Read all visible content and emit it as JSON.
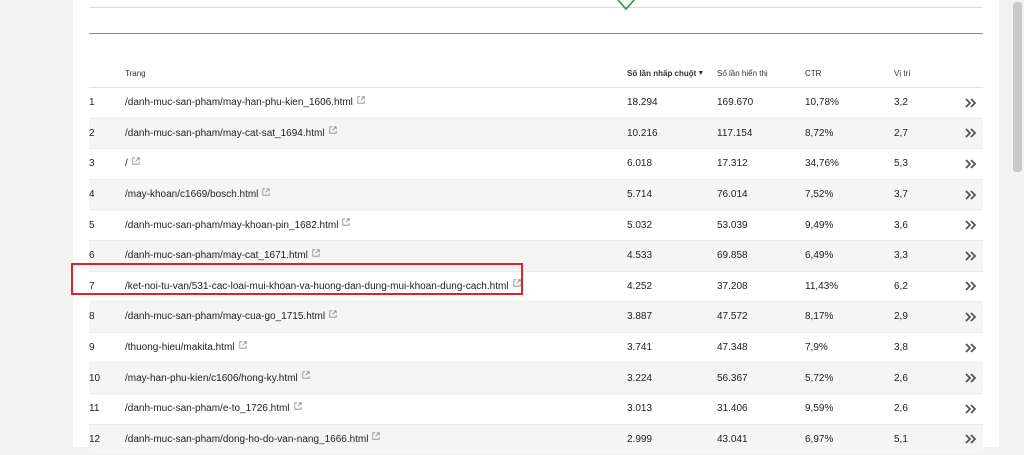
{
  "table": {
    "headers": {
      "page": "Trang",
      "clicks": "Số lần nhấp chuột",
      "sort_indicator": "▼",
      "impressions": "Số lần hiển thị",
      "ctr": "CTR",
      "position": "Vị trí"
    },
    "rows": [
      {
        "idx": "1",
        "page": "/danh-muc-san-pham/may-han-phu-kien_1606.html",
        "clicks": "18.294",
        "impressions": "169.670",
        "ctr": "10,78%",
        "position": "3,2"
      },
      {
        "idx": "2",
        "page": "/danh-muc-san-pham/may-cat-sat_1694.html",
        "clicks": "10.216",
        "impressions": "117.154",
        "ctr": "8,72%",
        "position": "2,7"
      },
      {
        "idx": "3",
        "page": "/",
        "clicks": "6.018",
        "impressions": "17.312",
        "ctr": "34,76%",
        "position": "5,3"
      },
      {
        "idx": "4",
        "page": "/may-khoan/c1669/bosch.html",
        "clicks": "5.714",
        "impressions": "76.014",
        "ctr": "7,52%",
        "position": "3,7"
      },
      {
        "idx": "5",
        "page": "/danh-muc-san-pham/may-khoan-pin_1682.html",
        "clicks": "5.032",
        "impressions": "53.039",
        "ctr": "9,49%",
        "position": "3,6"
      },
      {
        "idx": "6",
        "page": "/danh-muc-san-pham/may-cat_1671.html",
        "clicks": "4.533",
        "impressions": "69.858",
        "ctr": "6,49%",
        "position": "3,3"
      },
      {
        "idx": "7",
        "page": "/ket-noi-tu-van/531-cac-loai-mui-khoan-va-huong-dan-dung-mui-khoan-dung-cach.html",
        "clicks": "4.252",
        "impressions": "37.208",
        "ctr": "11,43%",
        "position": "6,2"
      },
      {
        "idx": "8",
        "page": "/danh-muc-san-pham/may-cua-go_1715.html",
        "clicks": "3.887",
        "impressions": "47.572",
        "ctr": "8,17%",
        "position": "2,9"
      },
      {
        "idx": "9",
        "page": "/thuong-hieu/makita.html",
        "clicks": "3.741",
        "impressions": "47.348",
        "ctr": "7,9%",
        "position": "3,8"
      },
      {
        "idx": "10",
        "page": "/may-han-phu-kien/c1606/hong-ky.html",
        "clicks": "3.224",
        "impressions": "56.367",
        "ctr": "5,72%",
        "position": "2,6"
      },
      {
        "idx": "11",
        "page": "/danh-muc-san-pham/e-to_1726.html",
        "clicks": "3.013",
        "impressions": "31.406",
        "ctr": "9,59%",
        "position": "2,6"
      },
      {
        "idx": "12",
        "page": "/danh-muc-san-pham/dong-ho-do-van-nang_1666.html",
        "clicks": "2.999",
        "impressions": "43.041",
        "ctr": "6,97%",
        "position": "5,1"
      }
    ]
  },
  "icons": {
    "external": "external-link-icon",
    "more": "double-chevron-right-icon",
    "chart_marker": "chevron-down-icon"
  },
  "colors": {
    "highlight": "#e0231e",
    "chart_marker": "#1e9e4a",
    "alt_row": "#f5f5f5"
  }
}
